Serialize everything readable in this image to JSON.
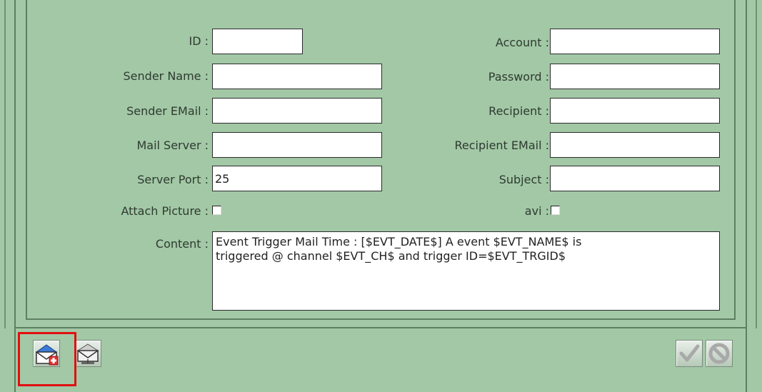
{
  "form": {
    "id_label": "ID :",
    "id_value": "",
    "sender_name_label": "Sender Name :",
    "sender_name_value": "",
    "sender_email_label": "Sender EMail :",
    "sender_email_value": "",
    "mail_server_label": "Mail Server :",
    "mail_server_value": "",
    "server_port_label": "Server Port :",
    "server_port_value": "25",
    "attach_picture_label": "Attach Picture :",
    "attach_picture_checked": false,
    "account_label": "Account :",
    "account_value": "",
    "password_label": "Password :",
    "password_value": "",
    "recipient_label": "Recipient :",
    "recipient_value": "",
    "recipient_email_label": "Recipient EMail :",
    "recipient_email_value": "",
    "subject_label": "Subject :",
    "subject_value": "",
    "avi_label": "avi :",
    "avi_checked": false,
    "content_label": "Content :",
    "content_value": "Event Trigger Mail Time : [$EVT_DATE$] A event $EVT_NAME$ is\ntriggered @ channel $EVT_CH$ and trigger ID=$EVT_TRGID$"
  },
  "toolbar": {
    "left_icons": [
      "add-mail-icon",
      "mail-send-icon"
    ],
    "right_icons": [
      "confirm-check-icon",
      "cancel-icon"
    ],
    "highlight_color": "#e01010"
  },
  "colors": {
    "panel": "#a3c8a6",
    "border": "#5e7f62"
  }
}
